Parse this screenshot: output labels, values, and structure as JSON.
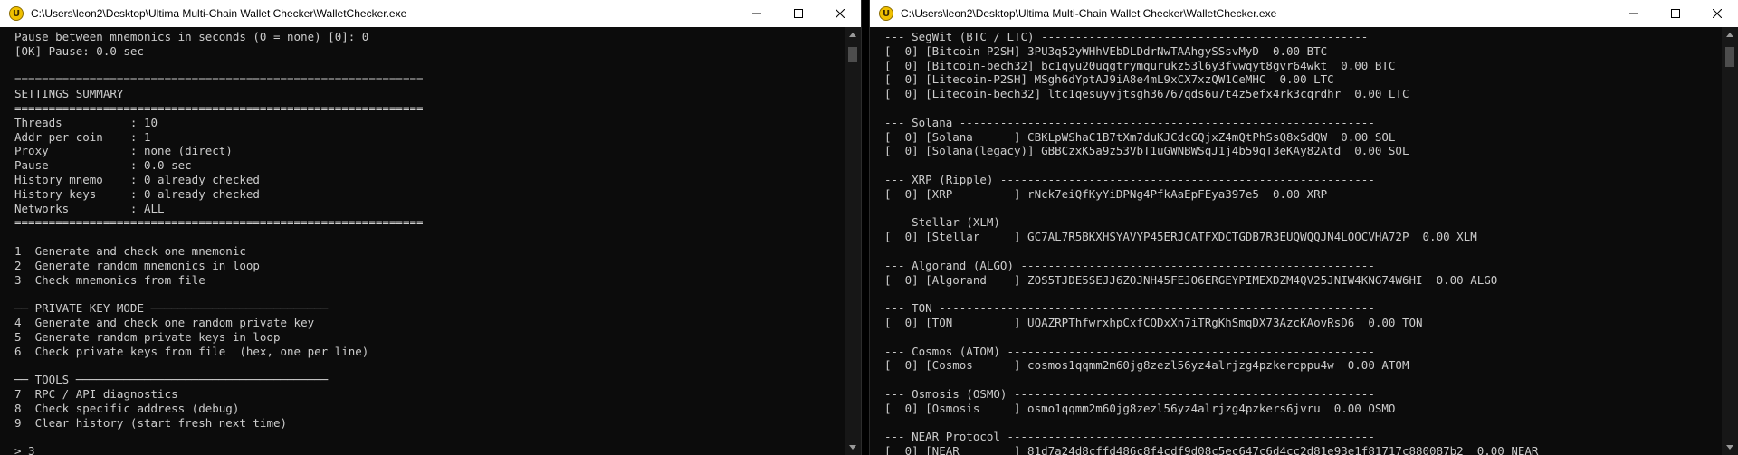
{
  "windows": [
    {
      "title": "C:\\Users\\leon2\\Desktop\\Ultima Multi-Chain Wallet Checker\\WalletChecker.exe",
      "lines": [
        "Pause between mnemonics in seconds (0 = none) [0]: 0",
        "[OK] Pause: 0.0 sec",
        "",
        "============================================================",
        "SETTINGS SUMMARY",
        "============================================================",
        "Threads          : 10",
        "Addr per coin    : 1",
        "Proxy            : none (direct)",
        "Pause            : 0.0 sec",
        "History mnemo    : 0 already checked",
        "History keys     : 0 already checked",
        "Networks         : ALL",
        "============================================================",
        "",
        "1  Generate and check one mnemonic",
        "2  Generate random mnemonics in loop",
        "3  Check mnemonics from file",
        "",
        "── PRIVATE KEY MODE ──────────────────────────",
        "4  Generate and check one random private key",
        "5  Generate random private keys in loop",
        "6  Check private keys from file  (hex, one per line)",
        "",
        "── TOOLS ─────────────────────────────────────",
        "7  RPC / API diagnostics",
        "8  Check specific address (debug)",
        "9  Clear history (start fresh next time)",
        "",
        "> 3"
      ]
    },
    {
      "title": "C:\\Users\\leon2\\Desktop\\Ultima Multi-Chain Wallet Checker\\WalletChecker.exe",
      "lines": [
        "--- SegWit (BTC / LTC) ------------------------------------------------",
        "[  0] [Bitcoin-P2SH] 3PU3q52yWHhVEbDLDdrNwTAAhgySSsvMyD  0.00 BTC",
        "[  0] [Bitcoin-bech32] bc1qyu20uqgtrymqurukz53l6y3fvwqyt8gvr64wkt  0.00 BTC",
        "[  0] [Litecoin-P2SH] MSgh6dYptAJ9iA8e4mL9xCX7xzQW1CeMHC  0.00 LTC",
        "[  0] [Litecoin-bech32] ltc1qesuyvjtsgh36767qds6u7t4z5efx4rk3cqrdhr  0.00 LTC",
        "",
        "--- Solana -------------------------------------------------------------",
        "[  0] [Solana      ] CBKLpWShaC1B7tXm7duKJCdcGQjxZ4mQtPhSsQ8xSdQW  0.00 SOL",
        "[  0] [Solana(legacy)] GBBCzxK5a9z53VbT1uGWNBWSqJ1j4b59qT3eKAy82Atd  0.00 SOL",
        "",
        "--- XRP (Ripple) -------------------------------------------------------",
        "[  0] [XRP         ] rNck7eiQfKyYiDPNg4PfkAaEpFEya397e5  0.00 XRP",
        "",
        "--- Stellar (XLM) ------------------------------------------------------",
        "[  0] [Stellar     ] GC7AL7R5BKXHSYAVYP45ERJCATFXDCTGDB7R3EUQWQQJN4LOOCVHA72P  0.00 XLM",
        "",
        "--- Algorand (ALGO) ----------------------------------------------------",
        "[  0] [Algorand    ] ZOS5TJDE5SEJJ6ZOJNH45FEJO6ERGEYPIMEXDZM4QV25JNIW4KNG74W6HI  0.00 ALGO",
        "",
        "--- TON ----------------------------------------------------------------",
        "[  0] [TON         ] UQAZRPThfwrxhpCxfCQDxXn7iTRgKhSmqDX73AzcKAovRsD6  0.00 TON",
        "",
        "--- Cosmos (ATOM) ------------------------------------------------------",
        "[  0] [Cosmos      ] cosmos1qqmm2m60jg8zezl56yz4alrjzg4pzkercppu4w  0.00 ATOM",
        "",
        "--- Osmosis (OSMO) -----------------------------------------------------",
        "[  0] [Osmosis     ] osmo1qqmm2m60jg8zezl56yz4alrjzg4pzkers6jvru  0.00 OSMO",
        "",
        "--- NEAR Protocol ------------------------------------------------------",
        "[  0] [NEAR        ] 81d7a24d8cffd486c8f4cdf9d08c5ec647c6d4cc2d81e93e1f81717c880087b2  0.00 NEAR"
      ]
    }
  ],
  "controls": {
    "minimize_icon": "minimize-icon",
    "maximize_icon": "maximize-icon",
    "close_icon": "close-icon"
  },
  "app_icon_letter": "U",
  "colors": {
    "console_bg": "#0c0c0c",
    "console_text": "#cccccc",
    "titlebar_bg": "#ffffff",
    "scroll_thumb": "#4d4d4d"
  }
}
